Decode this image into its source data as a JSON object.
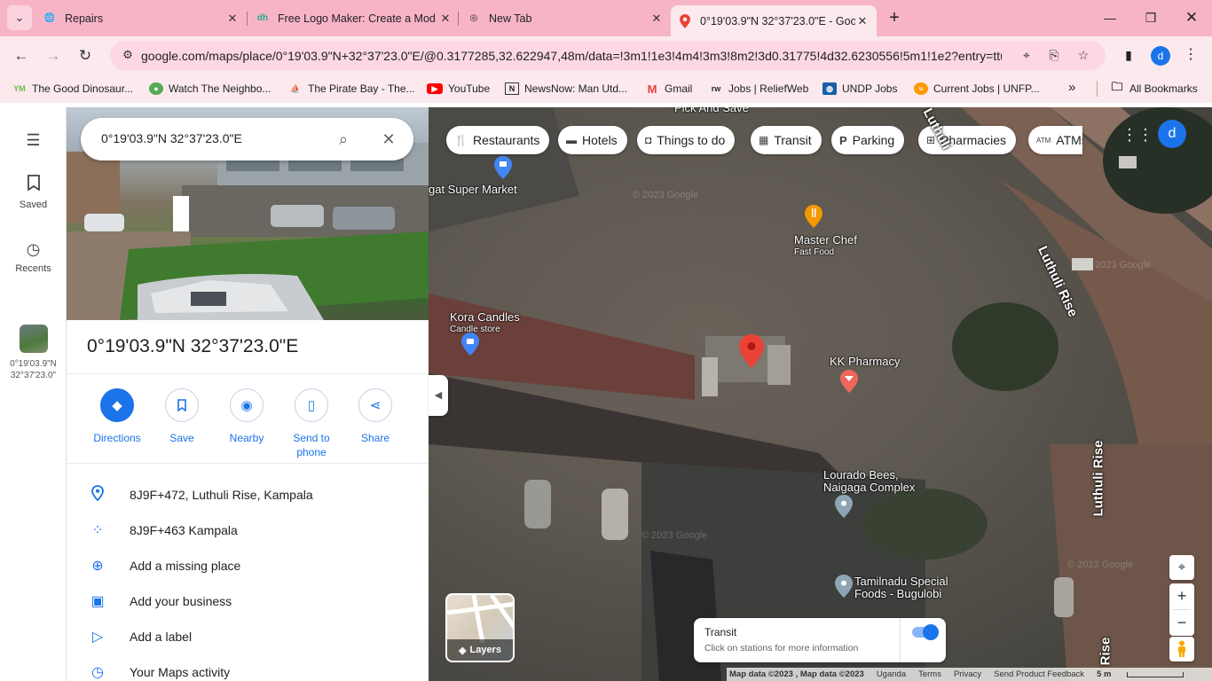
{
  "browser": {
    "tabs": [
      {
        "title": "Repairs",
        "icon": "globe-icon"
      },
      {
        "title": "Free Logo Maker: Create a Mod",
        "icon": "logo-maker-icon"
      },
      {
        "title": "New Tab",
        "icon": "chrome-icon"
      },
      {
        "title": "0°19'03.9\"N 32°37'23.0\"E - Goo",
        "icon": "maps-pin-icon",
        "active": true
      }
    ],
    "url": "google.com/maps/place/0°19'03.9\"N+32°37'23.0\"E/@0.3177285,32.622947,48m/data=!3m1!1e3!4m4!3m3!8m2!3d0.31775!4d32.6230556!5m1!1e2?entry=ttu",
    "profile_initial": "d",
    "bookmarks": [
      {
        "label": "The Good Dinosaur...",
        "icon": "ym-icon"
      },
      {
        "label": "Watch The Neighbo...",
        "icon": "fmovies-icon"
      },
      {
        "label": "The Pirate Bay - The...",
        "icon": "pirate-ship-icon"
      },
      {
        "label": "YouTube",
        "icon": "youtube-icon"
      },
      {
        "label": "NewsNow: Man Utd...",
        "icon": "newsnow-icon"
      },
      {
        "label": "Gmail",
        "icon": "gmail-icon"
      },
      {
        "label": "Jobs | ReliefWeb",
        "icon": "reliefweb-icon"
      },
      {
        "label": "UNDP Jobs",
        "icon": "un-icon"
      },
      {
        "label": "Current Jobs | UNFP...",
        "icon": "unfpa-icon"
      }
    ],
    "all_bookmarks": "All Bookmarks"
  },
  "rail": {
    "saved": "Saved",
    "recents": "Recents",
    "recent_place_line1": "0°19'03.9\"N",
    "recent_place_line2": "32°37'23.0\""
  },
  "search": {
    "query": "0°19'03.9\"N 32°37'23.0\"E"
  },
  "place": {
    "title": "0°19'03.9\"N 32°37'23.0\"E",
    "actions": [
      {
        "label": "Directions",
        "icon": "directions-icon"
      },
      {
        "label": "Save",
        "icon": "bookmark-icon"
      },
      {
        "label": "Nearby",
        "icon": "nearby-icon"
      },
      {
        "label": "Send to phone",
        "icon": "send-to-phone-icon"
      },
      {
        "label": "Share",
        "icon": "share-icon"
      }
    ],
    "info": [
      {
        "text": "8J9F+472, Luthuli Rise, Kampala",
        "icon": "location-pin-icon"
      },
      {
        "text": "8J9F+463 Kampala",
        "icon": "plus-code-icon"
      },
      {
        "text": "Add a missing place",
        "icon": "add-place-icon"
      },
      {
        "text": "Add your business",
        "icon": "add-business-icon"
      },
      {
        "text": "Add a label",
        "icon": "label-icon"
      },
      {
        "text": "Your Maps activity",
        "icon": "history-icon"
      }
    ]
  },
  "map": {
    "chips": [
      {
        "label": "Restaurants",
        "icon": "fork-knife-icon"
      },
      {
        "label": "Hotels",
        "icon": "bed-icon"
      },
      {
        "label": "Things to do",
        "icon": "camera-icon"
      },
      {
        "label": "Transit",
        "icon": "bus-icon"
      },
      {
        "label": "Parking",
        "icon": "parking-icon"
      },
      {
        "label": "Pharmacies",
        "icon": "pharmacy-icon"
      },
      {
        "label": "ATMs",
        "icon": "atm-icon"
      }
    ],
    "account_initial": "d",
    "places": {
      "pick_and_save": "Pick And Save",
      "super_market": "gat Super Market",
      "master_chef": "Master Chef",
      "master_chef_type": "Fast Food",
      "kora_candles": "Kora Candles",
      "kora_candles_type": "Candle store",
      "kk_pharmacy": "KK Pharmacy",
      "lourado_1": "Lourado Bees,",
      "lourado_2": "Naigaga Complex",
      "tamilnadu_1": "Tamilnadu Special",
      "tamilnadu_2": "Foods - Bugulobi"
    },
    "roads": {
      "luthuli_rise_a": "Luthuli Rise",
      "luthuli_rise_b": "Luthuli Rise",
      "luthuli_top": "Luthuli",
      "rise_bottom": "Rise"
    },
    "watermark": "© 2023 Google",
    "layers_label": "Layers",
    "transit_title": "Transit",
    "transit_sub": "Click on stations for more information",
    "transit_enabled": true,
    "attribution": {
      "map_data": "Map data ©2023 , Map data ©2023",
      "country": "Uganda",
      "terms": "Terms",
      "privacy": "Privacy",
      "feedback": "Send Product Feedback",
      "scale": "5 m"
    }
  },
  "colors": {
    "accent": "#1a73e8",
    "tabstrip": "#f8b4c7",
    "toolbar": "#fbe9ee",
    "pin_red": "#ea4335",
    "poi_orange": "#f29900",
    "poi_blue": "#4285f4",
    "poi_pink": "#ee675c"
  }
}
